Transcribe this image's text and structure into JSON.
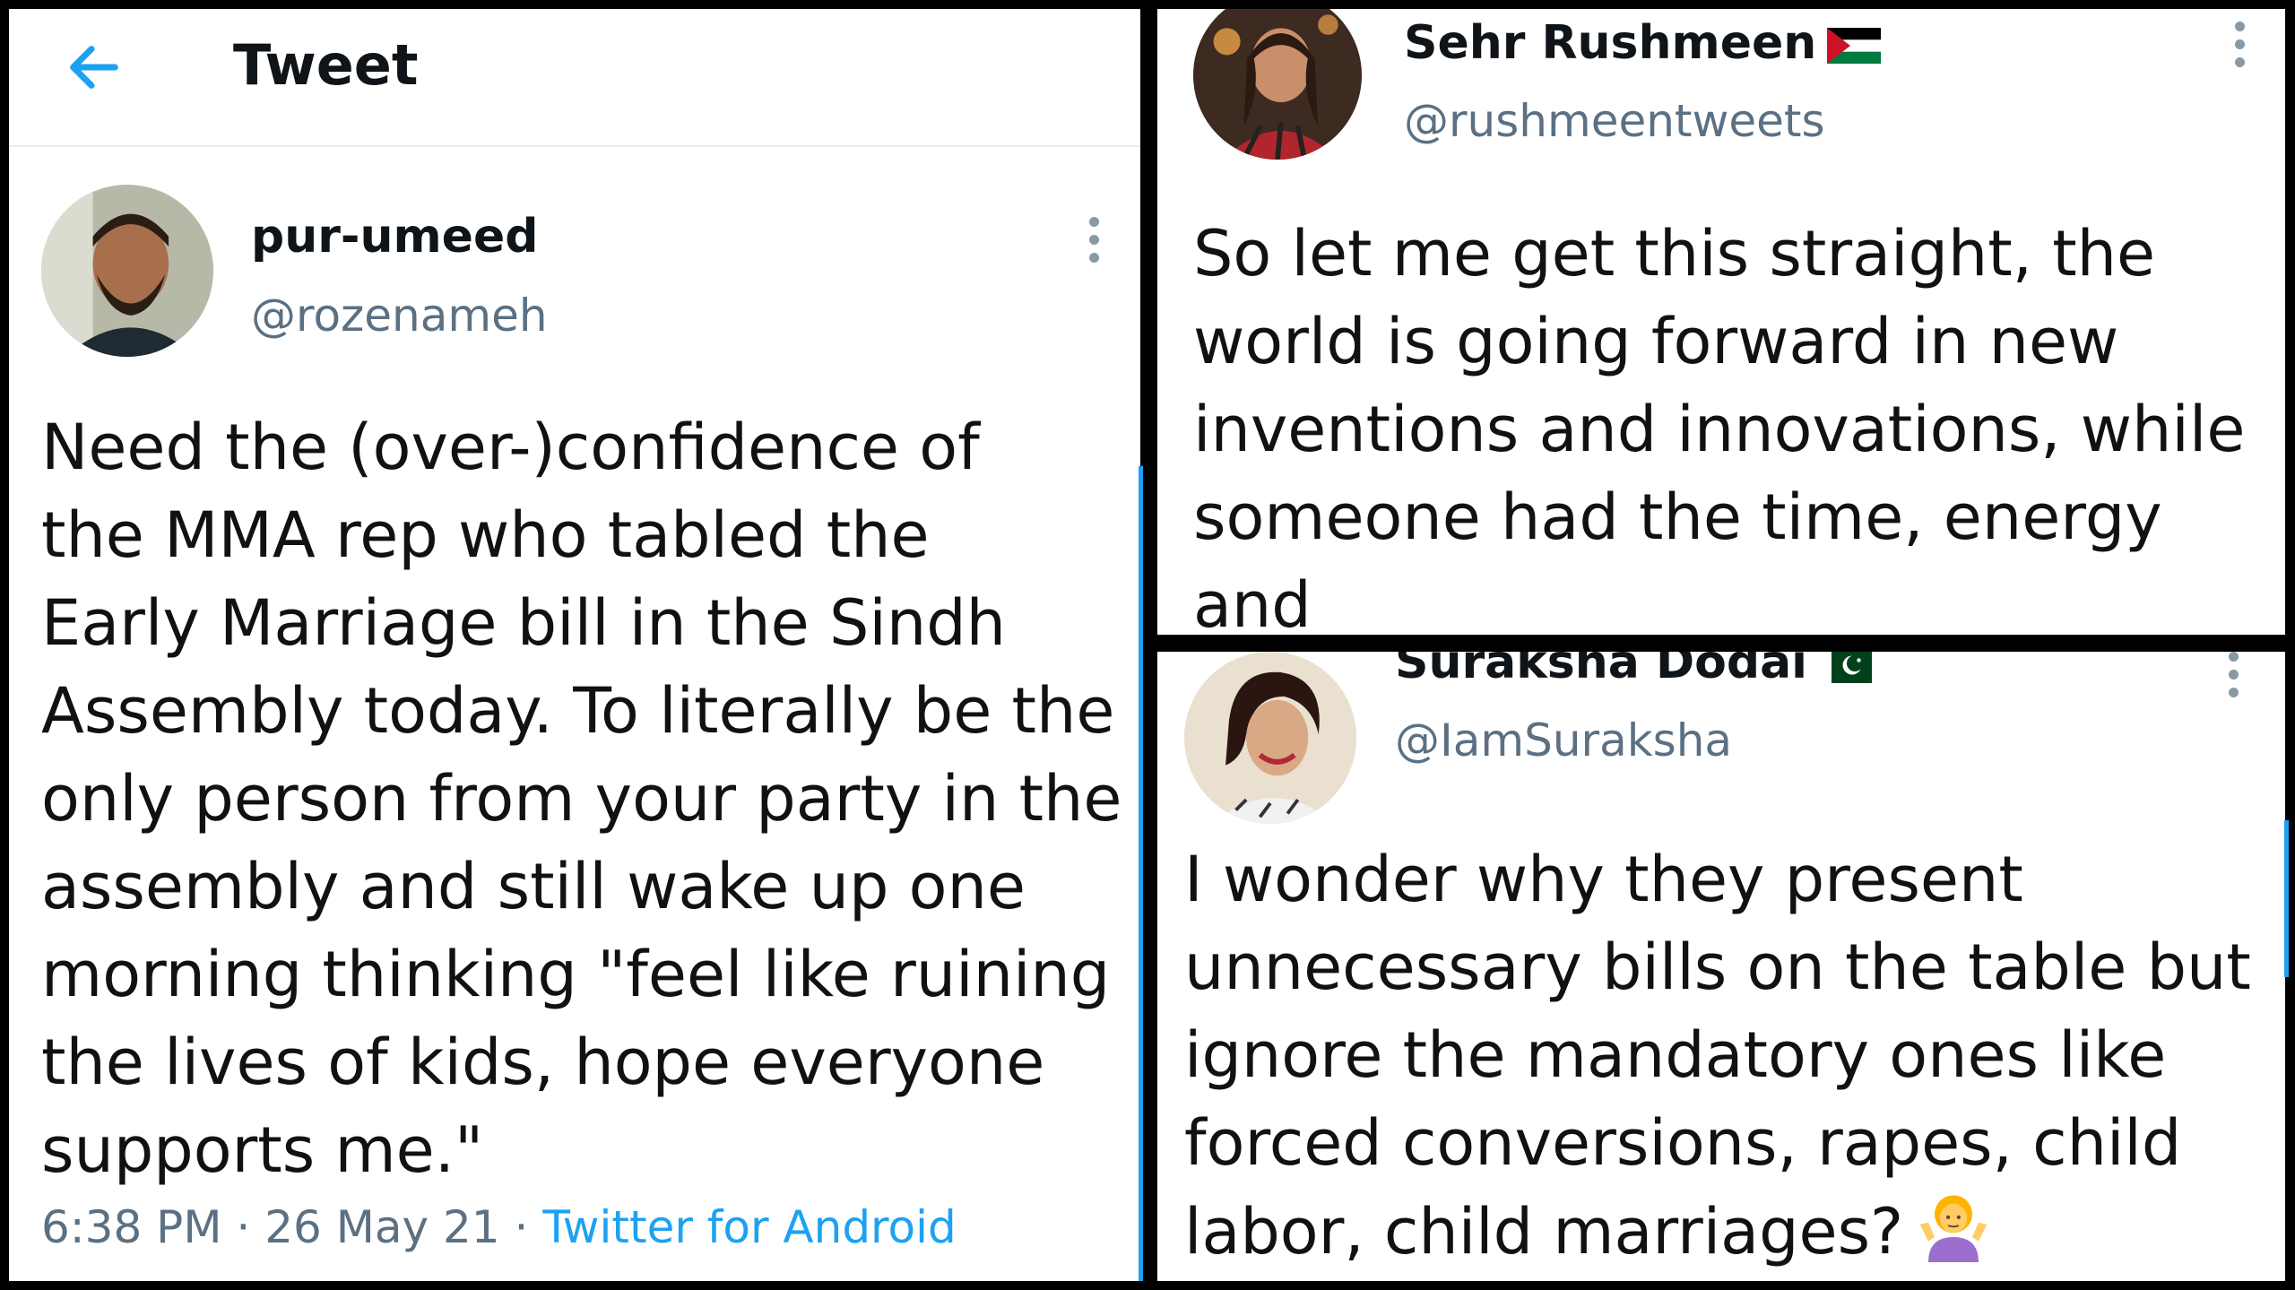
{
  "header": {
    "title": "Tweet"
  },
  "tweets": [
    {
      "name": "pur-umeed",
      "handle": "@rozenameh",
      "text": "Need the (over-)confidence of\nthe MMA rep who tabled the\nEarly Marriage bill in the Sindh\nAssembly today. To literally be the\nonly person from your party in the\nassembly and still wake up one\nmorning thinking \"feel like ruining\nthe lives of kids, hope everyone\nsupports me.\"",
      "time": "6:38 PM",
      "date": "26 May 21",
      "source": "Twitter for Android"
    },
    {
      "name": "Sehr Rushmeen",
      "handle": "@rushmeentweets",
      "flag_icon": "palestine-flag-icon",
      "text": "So let me get this straight, the\nworld is going forward in new\ninventions and innovations, while\nsomeone had the time, energy and\nthe AUDACITY to submit this bill"
    },
    {
      "name": "Suraksha Dodai",
      "handle": "@IamSuraksha",
      "flag_icon": "pakistan-flag-icon",
      "text": "I wonder why they present\nunnecessary bills on the table but\nignore the mandatory ones like\nforced conversions, rapes, child\nlabor, child marriages?",
      "emoji_icon": "person-shrugging-emoji-icon"
    }
  ],
  "meta_separator": "·",
  "colors": {
    "accent": "#1da1f2",
    "secondary_text": "#5b7083",
    "divider": "#e6ecf0"
  }
}
